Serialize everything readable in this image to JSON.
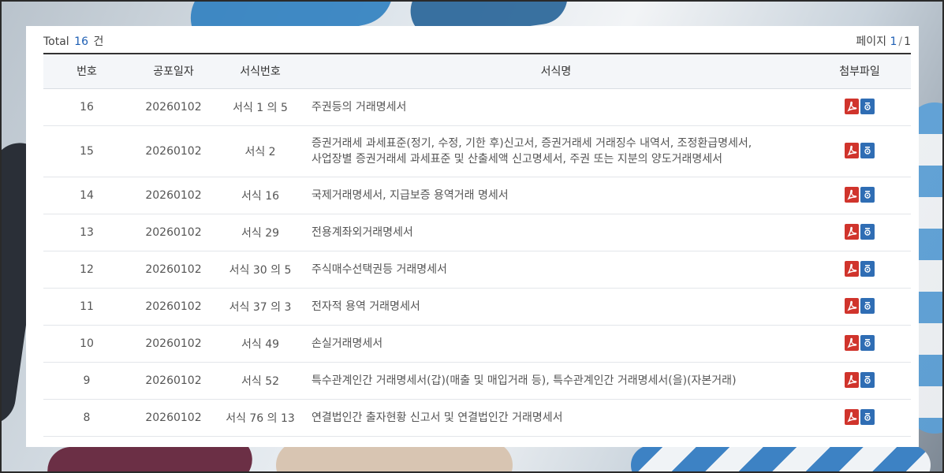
{
  "summary": {
    "total_label": "Total",
    "total_count": "16",
    "total_unit": "건",
    "page_label": "페이지",
    "page_current": "1",
    "page_sep": "/",
    "page_total": "1"
  },
  "table": {
    "headers": {
      "no": "번호",
      "date": "공포일자",
      "form_no": "서식번호",
      "form_name": "서식명",
      "files": "첨부파일"
    },
    "rows": [
      {
        "no": "16",
        "date": "20260102",
        "form_no": "서식 1 의 5",
        "name": "주권등의 거래명세서",
        "name2": ""
      },
      {
        "no": "15",
        "date": "20260102",
        "form_no": "서식 2",
        "name": "증권거래세 과세표준(정기, 수정, 기한 후)신고서, 증권거래세 거래징수 내역서, 조정환급명세서,",
        "name2": "사업장별 증권거래세 과세표준 및 산출세액 신고명세서, 주권 또는 지분의 양도거래명세서"
      },
      {
        "no": "14",
        "date": "20260102",
        "form_no": "서식 16",
        "name": "국제거래명세서, 지급보증 용역거래 명세서",
        "name2": ""
      },
      {
        "no": "13",
        "date": "20260102",
        "form_no": "서식 29",
        "name": "전용계좌외거래명세서",
        "name2": ""
      },
      {
        "no": "12",
        "date": "20260102",
        "form_no": "서식 30 의 5",
        "name": "주식매수선택권등 거래명세서",
        "name2": ""
      },
      {
        "no": "11",
        "date": "20260102",
        "form_no": "서식 37 의 3",
        "name": "전자적 용역 거래명세서",
        "name2": ""
      },
      {
        "no": "10",
        "date": "20260102",
        "form_no": "서식 49",
        "name": "손실거래명세서",
        "name2": ""
      },
      {
        "no": "9",
        "date": "20260102",
        "form_no": "서식 52",
        "name": "특수관계인간 거래명세서(갑)(매출 및 매입거래 등), 특수관계인간 거래명세서(을)(자본거래)",
        "name2": ""
      },
      {
        "no": "8",
        "date": "20260102",
        "form_no": "서식 76 의 13",
        "name": "연결법인간 출자현황 신고서 및 연결법인간 거래명세서",
        "name2": ""
      }
    ]
  },
  "icons": {
    "pdf": "pdf-file-icon",
    "hwp": "hwp-file-icon"
  },
  "colors": {
    "accent": "#1e5fb4",
    "pdf": "#d0342c",
    "hwp": "#2f6db4"
  }
}
